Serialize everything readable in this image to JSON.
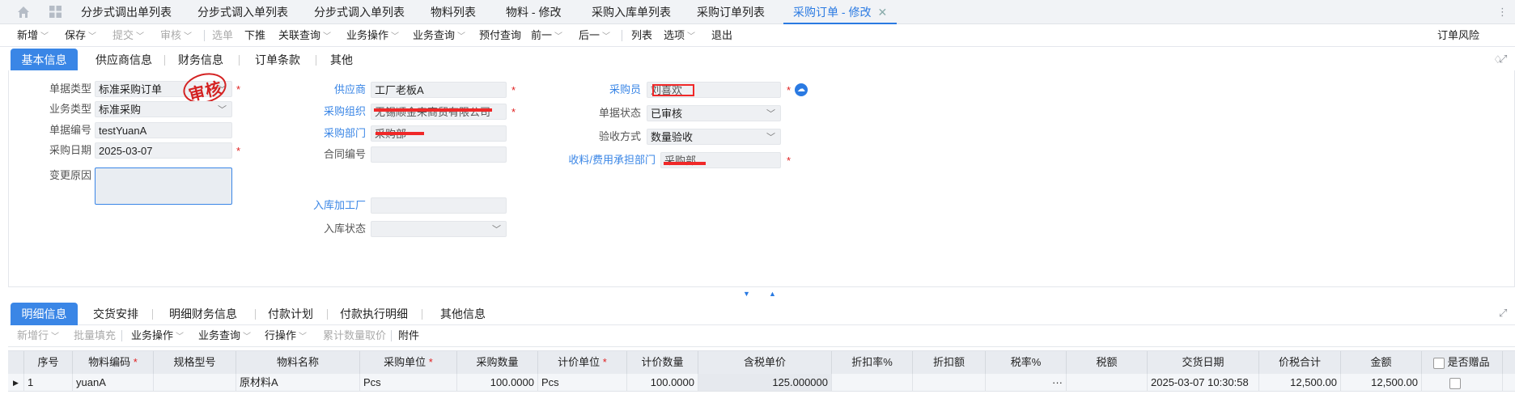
{
  "doc_tabs": [
    {
      "label": "分步式调出单列表"
    },
    {
      "label": "分步式调入单列表"
    },
    {
      "label": "分步式调入单列表"
    },
    {
      "label": "物料列表"
    },
    {
      "label": "物料 - 修改"
    },
    {
      "label": "采购入库单列表"
    },
    {
      "label": "采购订单列表"
    },
    {
      "label": "采购订单 - 修改",
      "active": true
    }
  ],
  "toolbar": {
    "items": [
      "新增",
      "保存",
      "提交",
      "审核",
      "选单",
      "下推",
      "关联查询",
      "业务操作",
      "业务查询",
      "预付查询",
      "前一",
      "后一",
      "列表",
      "选项",
      "退出"
    ],
    "right": "订单风险"
  },
  "head_tabs": [
    "基本信息",
    "供应商信息",
    "财务信息",
    "订单条款",
    "其他"
  ],
  "stamp": "审核",
  "form": {
    "bill_type_label": "单据类型",
    "bill_type": "标准采购订单",
    "biz_type_label": "业务类型",
    "biz_type": "标准采购",
    "bill_no_label": "单据编号",
    "bill_no": "testYuanA",
    "date_label": "采购日期",
    "date": "2025-03-07",
    "change_reason_label": "变更原因",
    "supplier_label": "供应商",
    "supplier": "工厂老板A",
    "org_label": "采购组织",
    "org": "无锡顺金来商贸有限公司",
    "dept_label": "采购部门",
    "dept": "采购部",
    "contract_label": "合同编号",
    "factory_label": "入库加工厂",
    "instock_status_label": "入库状态",
    "buyer_label": "采购员",
    "buyer": "刘喜欢",
    "status_label": "单据状态",
    "status": "已审核",
    "check_method_label": "验收方式",
    "check_method": "数量验收",
    "recv_dept_label": "收料/费用承担部门",
    "recv_dept": "采购部"
  },
  "detail_tabs": [
    "明细信息",
    "交货安排",
    "明细财务信息",
    "付款计划",
    "付款执行明细",
    "其他信息"
  ],
  "detail_tools": [
    "新增行",
    "批量填充",
    "业务操作",
    "业务查询",
    "行操作",
    "累计数量取价",
    "附件"
  ],
  "columns": [
    "序号",
    "物料编码",
    "规格型号",
    "物料名称",
    "采购单位",
    "采购数量",
    "计价单位",
    "计价数量",
    "含税单价",
    "折扣率%",
    "折扣额",
    "税率%",
    "税额",
    "交货日期",
    "价税合计",
    "金额",
    "是否赠品"
  ],
  "rows": [
    {
      "seq": "1",
      "code": "yuanA",
      "spec": "",
      "name": "原材料A",
      "unit": "Pcs",
      "qty": "100.0000",
      "price_unit": "Pcs",
      "price_qty": "100.0000",
      "tax_price": "125.000000",
      "discount_rate": "",
      "discount": "",
      "tax_rate": "···",
      "tax": "",
      "delivery": "2025-03-07 10:30:58",
      "total": "12,500.00",
      "amount": "12,500.00"
    }
  ]
}
